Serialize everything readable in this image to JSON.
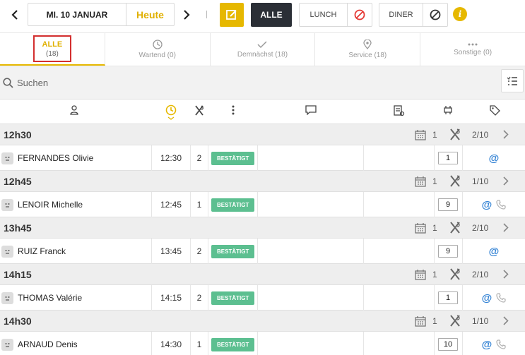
{
  "toolbar": {
    "date_label": "MI. 10 JANUAR",
    "today_label": "Heute",
    "all_label": "ALLE",
    "lunch_label": "LUNCH",
    "diner_label": "DINER",
    "accent_color": "#e6b800",
    "icons": [
      "chevron-left-icon",
      "chevron-right-icon",
      "edit-icon",
      "forbidden-icon",
      "block-icon",
      "info-icon"
    ]
  },
  "tabs": [
    {
      "title": "ALLE",
      "count": "(18)",
      "active": true
    },
    {
      "label": "Wartend (0)",
      "icon": "clock-icon"
    },
    {
      "label": "Demnächst (18)",
      "icon": "check-icon"
    },
    {
      "label": "Service (18)",
      "icon": "location-pin-icon"
    },
    {
      "label": "Sonstige (0)",
      "icon": "more-icon"
    }
  ],
  "search": {
    "placeholder": "Suchen"
  },
  "columns": [
    "person-icon",
    "clock-icon",
    "cutlery-icon",
    "more-vertical-icon",
    "comment-icon",
    "notes-icon",
    "table-icon",
    "tag-icon"
  ],
  "groups": [
    {
      "time": "12h30",
      "calendar_count": "1",
      "covers": "2/10",
      "reservation": {
        "guest": "FERNANDES Olivie",
        "time": "12:30",
        "persons": "2",
        "status": "BESTÄTIGT",
        "table": "1",
        "phone": false
      }
    },
    {
      "time": "12h45",
      "calendar_count": "1",
      "covers": "1/10",
      "reservation": {
        "guest": "LENOIR Michelle",
        "time": "12:45",
        "persons": "1",
        "status": "BESTÄTIGT",
        "table": "9",
        "phone": true
      }
    },
    {
      "time": "13h45",
      "calendar_count": "1",
      "covers": "2/10",
      "reservation": {
        "guest": "RUIZ Franck",
        "time": "13:45",
        "persons": "2",
        "status": "BESTÄTIGT",
        "table": "9",
        "phone": false
      }
    },
    {
      "time": "14h15",
      "calendar_count": "1",
      "covers": "2/10",
      "reservation": {
        "guest": "THOMAS Valérie",
        "time": "14:15",
        "persons": "2",
        "status": "BESTÄTIGT",
        "table": "1",
        "phone": true
      }
    },
    {
      "time": "14h30",
      "calendar_count": "1",
      "covers": "1/10",
      "reservation": {
        "guest": "ARNAUD Denis",
        "time": "14:30",
        "persons": "1",
        "status": "BESTÄTIGT",
        "table": "10",
        "phone": true
      }
    }
  ],
  "contact_symbol": "@",
  "status_color": "#5cbf90"
}
